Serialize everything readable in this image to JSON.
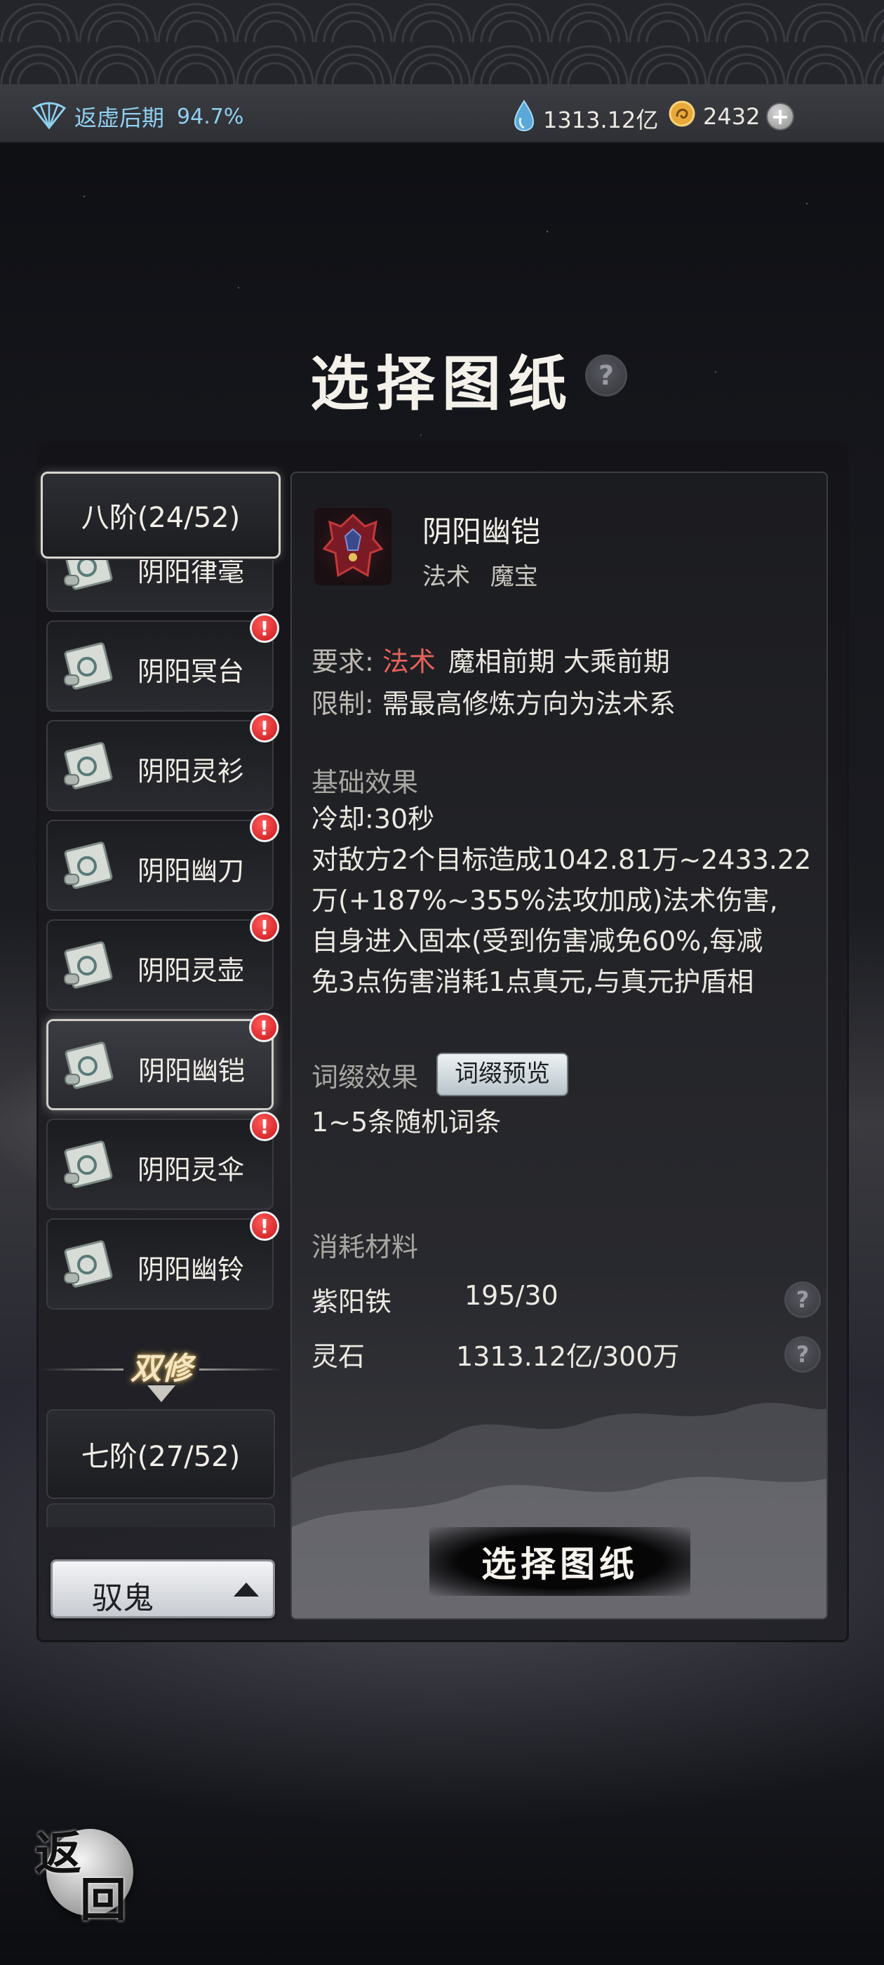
{
  "status_bar": {
    "realm_label": "返虚后期",
    "realm_progress": "94.7%",
    "spirit_stone": "1313.12亿",
    "gold": "2432",
    "add_label": "+"
  },
  "title": "选择图纸",
  "help_label": "?",
  "list": {
    "tier_header": "八阶(24/52)",
    "items": [
      {
        "label": "阴阳律毫",
        "alert": "!"
      },
      {
        "label": "阴阳冥台",
        "alert": "!"
      },
      {
        "label": "阴阳灵衫",
        "alert": "!"
      },
      {
        "label": "阴阳幽刀",
        "alert": "!"
      },
      {
        "label": "阴阳灵壶",
        "alert": "!"
      },
      {
        "label": "阴阳幽铠",
        "alert": "!"
      },
      {
        "label": "阴阳灵伞",
        "alert": "!"
      },
      {
        "label": "阴阳幽铃",
        "alert": "!"
      }
    ],
    "selected_index": 5,
    "divider_label": "双修",
    "next_tier": "七阶(27/52)",
    "school_select": "驭鬼"
  },
  "detail": {
    "name": "阴阳幽铠",
    "tag1": "法术",
    "tag2": "魔宝",
    "req_label": "要求:",
    "req_highlight": "法术",
    "req_text": "魔相前期 大乘前期",
    "limit_label": "限制:",
    "limit_text": "需最高修炼方向为法术系",
    "base_title": "基础效果",
    "cooldown": "冷却:30秒",
    "effect_lines": [
      "对敌方2个目标造成1042.81万~2433.22",
      "万(+187%~355%法攻加成)法术伤害,",
      "自身进入固本(受到伤害减免60%,每减",
      "免3点伤害消耗1点真元,与真元护盾相"
    ],
    "affix_title": "词缀效果",
    "affix_preview": "词缀预览",
    "affix_text": "1~5条随机词条",
    "materials_title": "消耗材料",
    "materials": [
      {
        "name": "紫阳铁",
        "qty": "195/30"
      },
      {
        "name": "灵石",
        "qty": "1313.12亿/300万"
      }
    ],
    "confirm_button": "选择图纸"
  },
  "back_button": {
    "char1": "返",
    "char2": "回"
  },
  "colors": {
    "accent_blue": "#8fd0f0",
    "requirement_red": "#e7605a",
    "alert_red": "#d8202a"
  }
}
